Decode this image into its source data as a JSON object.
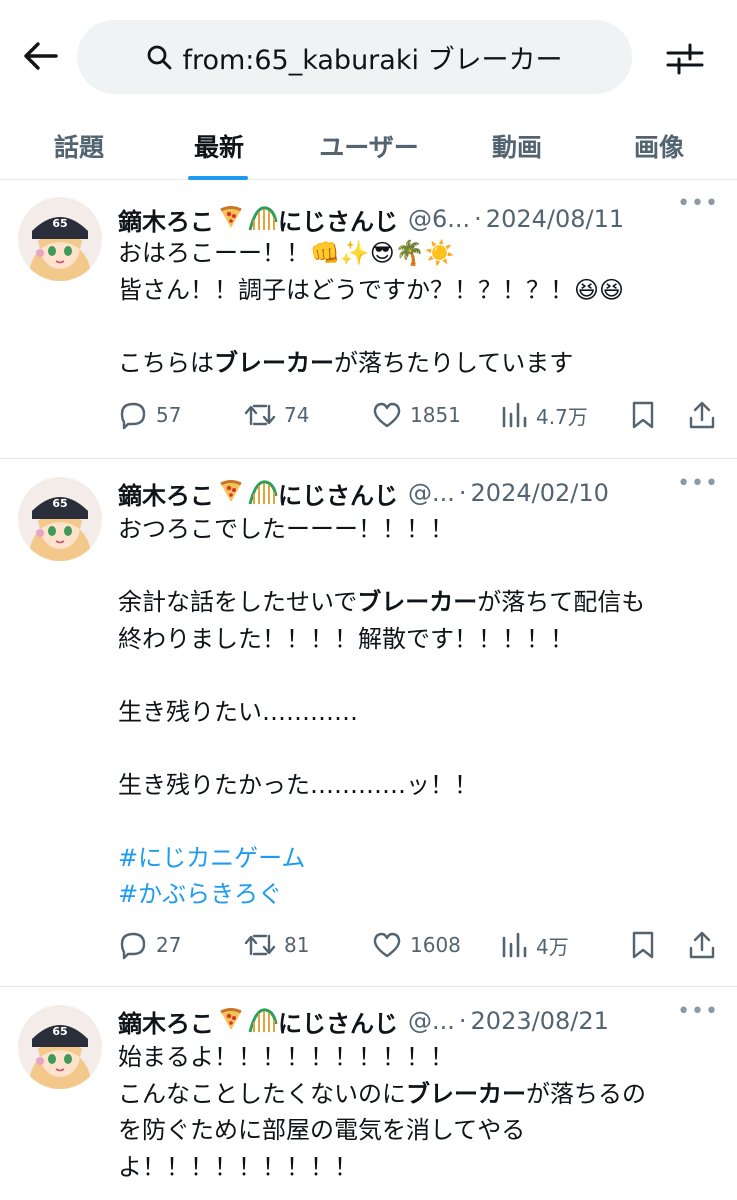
{
  "search": {
    "query": "from:65_kaburaki ブレーカー"
  },
  "tabs": [
    {
      "label": "話題"
    },
    {
      "label": "最新"
    },
    {
      "label": "ユーザー"
    },
    {
      "label": "動画"
    },
    {
      "label": "画像"
    }
  ],
  "active_tab": "最新",
  "colors": {
    "accent": "#1d9bf0",
    "text": "#0f1419",
    "muted": "#536471",
    "search_bg": "#eff3f4"
  },
  "tweets": [
    {
      "display_name": "鏑木ろこ",
      "badges": [
        "pizza-emoji",
        "rollercoaster-emoji"
      ],
      "org": "にじさんじ",
      "handle": "@6...",
      "date": "2024/08/11",
      "lines": [
        [
          {
            "t": "おはろこーー！！👊✨😎🌴☀️"
          }
        ],
        [
          {
            "t": "皆さん！！調子はどうですか？！？！？！😆😆"
          }
        ],
        [
          {
            "t": ""
          }
        ],
        [
          {
            "t": "こちらは"
          },
          {
            "t": "ブレーカー",
            "b": true
          },
          {
            "t": "が落ちたりしています"
          }
        ]
      ],
      "replies": "57",
      "retweets": "74",
      "likes": "1851",
      "views": "4.7万"
    },
    {
      "display_name": "鏑木ろこ",
      "badges": [
        "pizza-emoji",
        "rollercoaster-emoji"
      ],
      "org": "にじさんじ",
      "handle": "@...",
      "date": "2024/02/10",
      "lines": [
        [
          {
            "t": "おつろこでしたーーー！！！！"
          }
        ],
        [
          {
            "t": ""
          }
        ],
        [
          {
            "t": "余計な話をしたせいで"
          },
          {
            "t": "ブレーカー",
            "b": true
          },
          {
            "t": "が落ちて配信も"
          }
        ],
        [
          {
            "t": "終わりました！！！！解散です！！！！！"
          }
        ],
        [
          {
            "t": ""
          }
        ],
        [
          {
            "t": "生き残りたい…………"
          }
        ],
        [
          {
            "t": ""
          }
        ],
        [
          {
            "t": "生き残りたかった…………ッ！！"
          }
        ],
        [
          {
            "t": ""
          }
        ],
        [
          {
            "t": "#にじカニゲーム",
            "h": true
          }
        ],
        [
          {
            "t": "#かぶらきろぐ",
            "h": true
          }
        ]
      ],
      "replies": "27",
      "retweets": "81",
      "likes": "1608",
      "views": "4万"
    },
    {
      "display_name": "鏑木ろこ",
      "badges": [
        "pizza-emoji",
        "rollercoaster-emoji"
      ],
      "org": "にじさんじ",
      "handle": "@...",
      "date": "2023/08/21",
      "lines": [
        [
          {
            "t": "始まるよ！！！！！！！！！！"
          }
        ],
        [
          {
            "t": "こんなことしたくないのに"
          },
          {
            "t": "ブレーカー",
            "b": true
          },
          {
            "t": "が落ちるの"
          }
        ],
        [
          {
            "t": "を防ぐために部屋の電気を消してやる"
          }
        ],
        [
          {
            "t": "よ！！！！！！！！！"
          }
        ]
      ]
    }
  ]
}
